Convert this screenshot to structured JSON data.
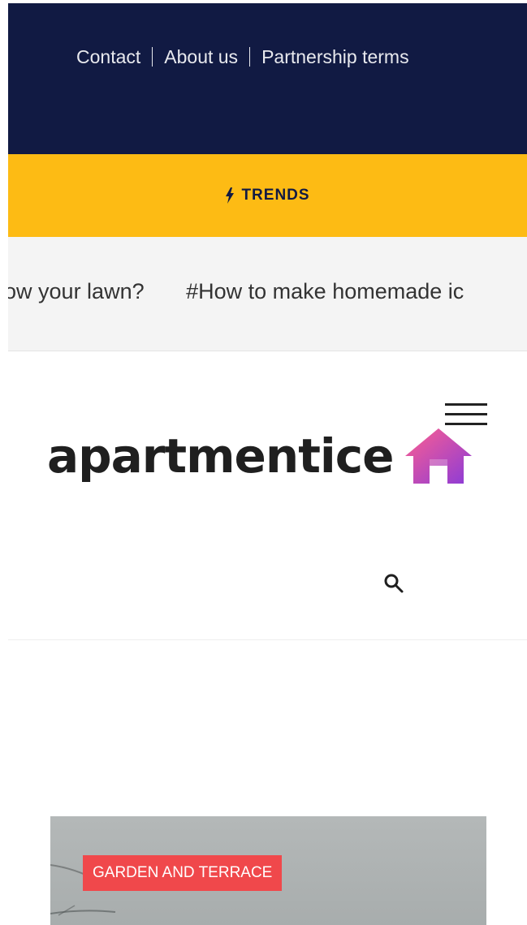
{
  "top_nav": {
    "links": [
      "Contact",
      "About us",
      "Partnership terms"
    ]
  },
  "trends": {
    "label": "TRENDS",
    "icon": "lightning-icon"
  },
  "ticker": {
    "items": [
      "now your lawn?",
      "#How to make homemade ic"
    ]
  },
  "header": {
    "logo_text": "apartmentice",
    "logo_icon": "house-icon",
    "menu_icon": "hamburger-icon",
    "search_icon": "search-icon"
  },
  "feature": {
    "category": "GARDEN AND TERRACE"
  },
  "colors": {
    "navy": "#111a43",
    "yellow": "#fdbb14",
    "ticker_bg": "#f4f4f4",
    "badge_red": "#f0484b",
    "logo_pink": "#ff5f8f",
    "logo_purple": "#8a3bd8"
  }
}
